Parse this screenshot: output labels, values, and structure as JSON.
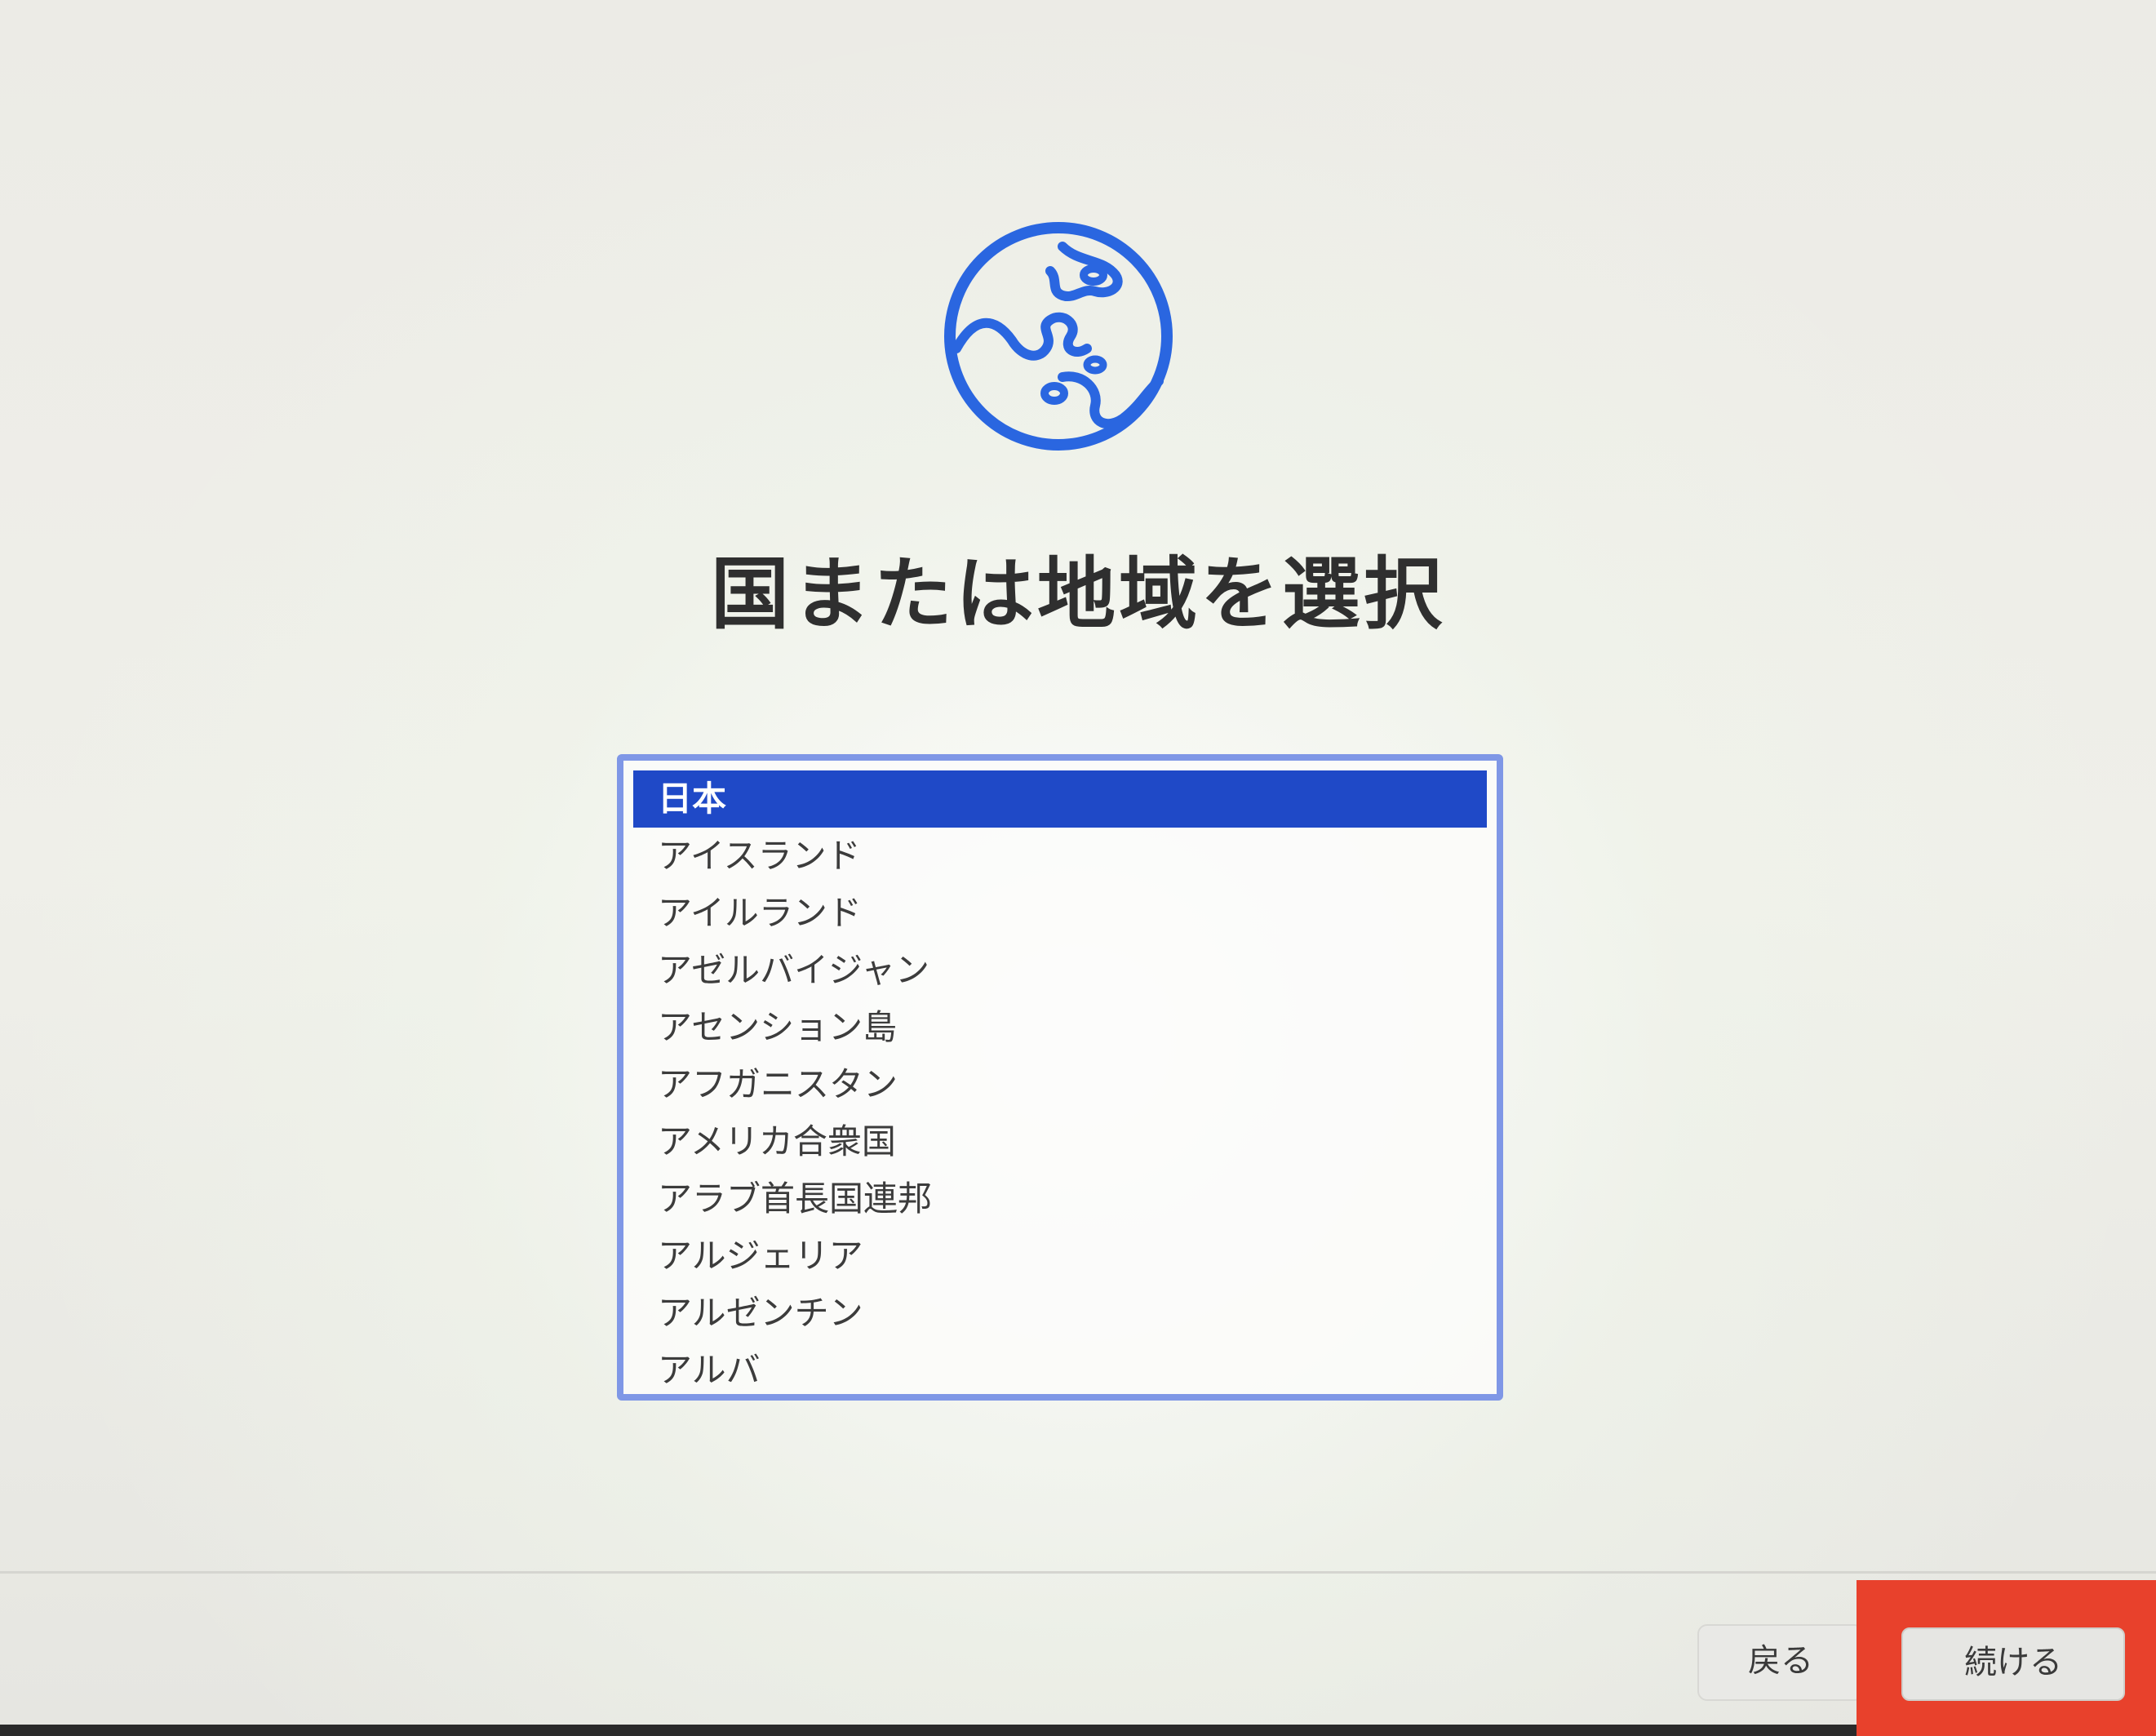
{
  "title": "国または地域を選択",
  "icons": {
    "globe": "globe-icon"
  },
  "colors": {
    "accent": "#1f49c7",
    "list_border": "#7f97e6",
    "highlight": "#e8412c",
    "globe_stroke": "#2a66e0"
  },
  "countries": [
    "日本",
    "アイスランド",
    "アイルランド",
    "アゼルバイジャン",
    "アセンション島",
    "アフガニスタン",
    "アメリカ合衆国",
    "アラブ首長国連邦",
    "アルジェリア",
    "アルゼンチン",
    "アルバ"
  ],
  "selected_country": "日本",
  "buttons": {
    "back": "戻る",
    "continue": "続ける"
  }
}
